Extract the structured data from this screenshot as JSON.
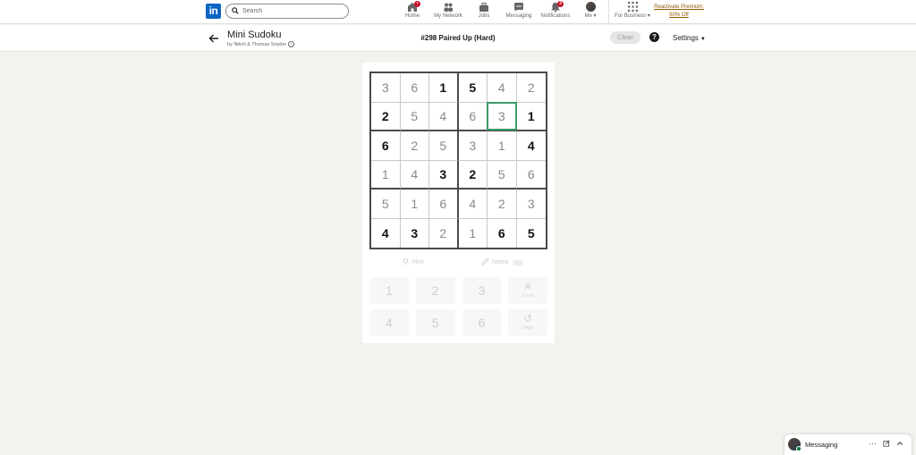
{
  "nav": {
    "search_placeholder": "Search",
    "items": [
      {
        "label": "Home",
        "icon": "home-icon",
        "badge": ""
      },
      {
        "label": "My Network",
        "icon": "people-icon",
        "badge": ""
      },
      {
        "label": "Jobs",
        "icon": "briefcase-icon",
        "badge": ""
      },
      {
        "label": "Messaging",
        "icon": "chat-icon",
        "badge": ""
      },
      {
        "label": "Notifications",
        "icon": "bell-icon",
        "badge": "3"
      },
      {
        "label": "Me",
        "icon": "avatar",
        "badge": ""
      },
      {
        "label": "For Business",
        "icon": "grid-icon",
        "badge": ""
      }
    ],
    "premium_line1": "Reactivate Premium:",
    "premium_line2": "50% Off"
  },
  "game": {
    "title": "Mini Sudoku",
    "byline": "by Nikoli & Thomas Snyder",
    "puzzle": "#298 Paired Up (Hard)",
    "clear_label": "Clear",
    "help_label": "?",
    "settings_label": "Settings",
    "grid": [
      [
        "3",
        "6",
        "1",
        "5",
        "4",
        "2"
      ],
      [
        "2",
        "5",
        "4",
        "6",
        "3",
        "1"
      ],
      [
        "6",
        "2",
        "5",
        "3",
        "1",
        "4"
      ],
      [
        "1",
        "4",
        "3",
        "2",
        "5",
        "6"
      ],
      [
        "5",
        "1",
        "6",
        "4",
        "2",
        "3"
      ],
      [
        "4",
        "3",
        "2",
        "1",
        "6",
        "5"
      ]
    ],
    "givens": [
      [
        false,
        false,
        true,
        true,
        false,
        false
      ],
      [
        true,
        false,
        false,
        false,
        false,
        true
      ],
      [
        true,
        false,
        false,
        false,
        false,
        true
      ],
      [
        false,
        false,
        true,
        true,
        false,
        false
      ],
      [
        false,
        false,
        false,
        false,
        false,
        false
      ],
      [
        true,
        true,
        false,
        false,
        true,
        true
      ]
    ],
    "selected_cell": {
      "row": 2,
      "col": 5
    },
    "hint_label": "Hint",
    "notes_label": "Notes",
    "keys": [
      "1",
      "2",
      "3",
      "4",
      "5",
      "6"
    ],
    "erase_label": "Erase",
    "undo_label": "Undo"
  },
  "messaging": {
    "label": "Messaging"
  },
  "colors": {
    "linkedin_blue": "#0a66c2",
    "selection_green": "#3a9a6a",
    "badge_red": "#cb112d",
    "premium_gold": "#915907"
  }
}
